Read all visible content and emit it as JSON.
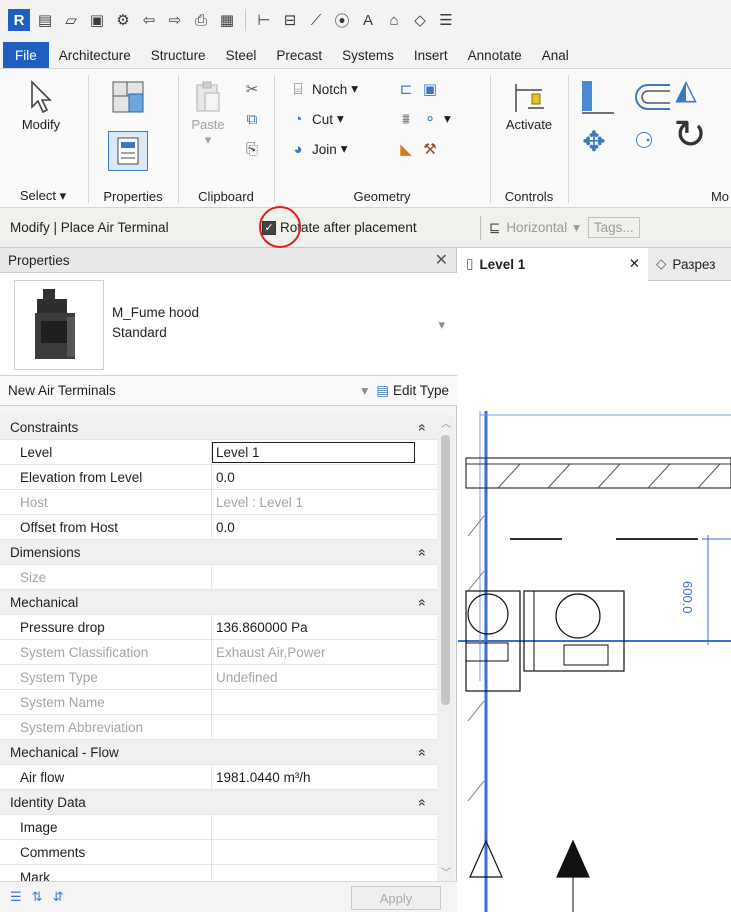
{
  "qat": {
    "logo": "R"
  },
  "tabs": [
    "File",
    "Architecture",
    "Structure",
    "Steel",
    "Precast",
    "Systems",
    "Insert",
    "Annotate",
    "Anal"
  ],
  "ribbon": {
    "modify_label": "Modify",
    "paste_label": "Paste",
    "notch_label": "Notch",
    "cut_label": "Cut",
    "join_label": "Join",
    "activate_label": "Activate",
    "groups": {
      "select": "Select",
      "properties": "Properties",
      "clipboard": "Clipboard",
      "geometry": "Geometry",
      "controls": "Controls",
      "mo": "Mo"
    }
  },
  "options_bar": {
    "context": "Modify | Place Air Terminal",
    "rotate_label": "Rotate after placement",
    "rotate_checked": true,
    "orientation": "Horizontal",
    "tags_label": "Tags..."
  },
  "properties": {
    "header": "Properties",
    "type_family": "M_Fume hood",
    "type_name": "Standard",
    "instance_filter": "New Air Terminals",
    "edit_type": "Edit Type",
    "apply": "Apply",
    "rows": [
      {
        "kind": "cat",
        "label": "Constraints"
      },
      {
        "kind": "row",
        "key": "Level",
        "value": "Level 1",
        "boxed": true
      },
      {
        "kind": "row",
        "key": "Elevation from Level",
        "value": "0.0"
      },
      {
        "kind": "dim",
        "key": "Host",
        "value": "Level : Level 1"
      },
      {
        "kind": "row",
        "key": "Offset from Host",
        "value": "0.0"
      },
      {
        "kind": "cat",
        "label": "Dimensions"
      },
      {
        "kind": "dim",
        "key": "Size",
        "value": ""
      },
      {
        "kind": "cat",
        "label": "Mechanical"
      },
      {
        "kind": "row",
        "key": "Pressure drop",
        "value": "136.860000 Pa"
      },
      {
        "kind": "dim",
        "key": "System Classification",
        "value": "Exhaust Air,Power"
      },
      {
        "kind": "dim",
        "key": "System Type",
        "value": "Undefined"
      },
      {
        "kind": "dim",
        "key": "System Name",
        "value": ""
      },
      {
        "kind": "dim",
        "key": "System Abbreviation",
        "value": ""
      },
      {
        "kind": "cat",
        "label": "Mechanical - Flow"
      },
      {
        "kind": "row",
        "key": "Air flow",
        "value": "1981.0440 m³/h"
      },
      {
        "kind": "cat",
        "label": "Identity Data"
      },
      {
        "kind": "row",
        "key": "Image",
        "value": ""
      },
      {
        "kind": "row",
        "key": "Comments",
        "value": ""
      },
      {
        "kind": "row",
        "key": "Mark",
        "value": ""
      }
    ]
  },
  "view": {
    "active_tab": "Level 1",
    "second_tab": "Разрез",
    "dimension_text": "600.0"
  }
}
